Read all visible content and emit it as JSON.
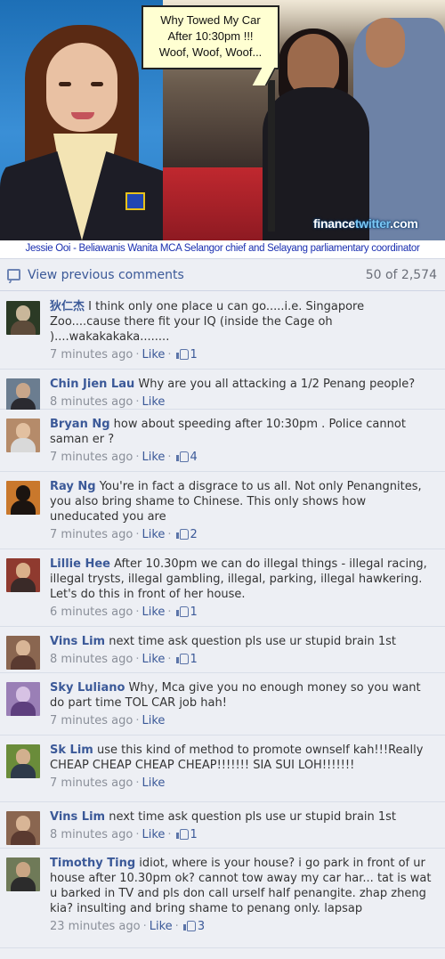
{
  "banner": {
    "speech_bubble": [
      "Why Towed My Car",
      "After 10:30pm !!!",
      "Woof, Woof, Woof..."
    ],
    "watermark_prefix": "finance",
    "watermark_accent": "twitter",
    "watermark_suffix": ".com",
    "caption": "Jessie Ooi - Beliawanis Wanita MCA Selangor chief and Selayang parliamentary coordinator",
    "caption_color": "#1a2fb0"
  },
  "comments_header": {
    "view_previous_label": "View previous comments",
    "count_label": "50 of 2,574",
    "icon": "speech-bubble-icon"
  },
  "like_label": "Like",
  "comments": [
    {
      "author": "狄仁杰",
      "text": "I think only one place u can go.....i.e. Singapore Zoo....cause there fit your IQ (inside the Cage oh )....wakakakaka........",
      "time": "7 minutes ago",
      "likes": "1",
      "avatar_colors": [
        "#2b3a25",
        "#c9b79a",
        "#5d4b3a"
      ]
    },
    {
      "author": "Chin Jien Lau",
      "text": "Why are you all attacking a 1/2 Penang people?",
      "time": "8 minutes ago",
      "likes": "",
      "avatar_colors": [
        "#6b7d90",
        "#c8a68a",
        "#2a2a30"
      ]
    },
    {
      "author": "Bryan Ng",
      "text": "how about speeding after 10:30pm . Police cannot saman er ?",
      "time": "7 minutes ago",
      "likes": "4",
      "avatar_colors": [
        "#b58b6a",
        "#e2c0a0",
        "#d9d9d9"
      ]
    },
    {
      "author": "Ray Ng",
      "text": "You're in fact a disgrace to us all. Not only Penangnites, you also bring shame to Chinese. This only shows how uneducated you are",
      "time": "7 minutes ago",
      "likes": "2",
      "avatar_colors": [
        "#c9782c",
        "#1b1410",
        "#1b1410"
      ]
    },
    {
      "author": "Lillie Hee",
      "text": "After 10.30pm we can do illegal things - illegal racing, illegal trysts, illegal gambling, illegal, parking, illegal hawkering. Let's do this in front of her house.",
      "time": "6 minutes ago",
      "likes": "1",
      "avatar_colors": [
        "#8f3a2f",
        "#d9b08a",
        "#3a2a28"
      ]
    },
    {
      "author": "Vins Lim",
      "text": "next time ask question pls use ur stupid brain 1st",
      "time": "8 minutes ago",
      "likes": "1",
      "avatar_colors": [
        "#8a6650",
        "#d8b596",
        "#5a3a30"
      ]
    },
    {
      "author": "Sky Luliano",
      "text": "Why, Mca give you no enough money so you want do part time TOL CAR job hah!",
      "time": "7 minutes ago",
      "likes": "",
      "avatar_colors": [
        "#9a7fb6",
        "#d7c2e4",
        "#5e3f7e"
      ]
    },
    {
      "author": "Sk Lim",
      "text": "use this kind of method to promote ownself kah!!!Really CHEAP CHEAP CHEAP CHEAP!!!!!!! SIA SUI LOH!!!!!!!",
      "time": "7 minutes ago",
      "likes": "",
      "avatar_colors": [
        "#6a8c3a",
        "#d2b08e",
        "#2e3a4a"
      ]
    },
    {
      "author": "Vins Lim",
      "text": "next time ask question pls use ur stupid brain 1st",
      "time": "8 minutes ago",
      "likes": "1",
      "avatar_colors": [
        "#8a6650",
        "#d8b596",
        "#5a3a30"
      ]
    },
    {
      "author": "Timothy Ting",
      "text": "idiot, where is your house? i go park in front of ur house after 10.30pm ok? cannot tow away my car har... tat is wat u barked in TV and pls don call urself half penangite. zhap zheng kia? insulting and bring shame to penang only. lapsap",
      "time": "23 minutes ago",
      "likes": "3",
      "avatar_colors": [
        "#6f7a58",
        "#c9a584",
        "#2c2c2c"
      ]
    }
  ]
}
